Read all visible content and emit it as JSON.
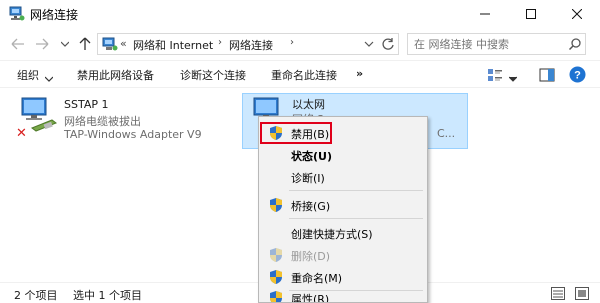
{
  "window": {
    "title": "网络连接",
    "controls": [
      "minimize",
      "maximize",
      "close"
    ]
  },
  "navigation": {
    "address_prefix": "«",
    "breadcrumbs": [
      "网络和 Internet",
      "网络连接"
    ],
    "search_placeholder": "在 网络连接 中搜索"
  },
  "toolbar": {
    "organize": "组织",
    "disable_device": "禁用此网络设备",
    "diagnose": "诊断这个连接",
    "rename": "重命名此连接",
    "more": "»"
  },
  "connections": [
    {
      "name": "SSTAP 1",
      "status": "网络电缆被拔出",
      "adapter": "TAP-Windows Adapter V9",
      "error_mark": "✕",
      "selected": false
    },
    {
      "name": "以太网",
      "status": "网络 2",
      "adapter": "C...",
      "selected": true
    }
  ],
  "context_menu": {
    "items": [
      {
        "label": "禁用(B)",
        "shield": true,
        "bold": false,
        "disabled": false,
        "highlighted": true
      },
      {
        "label": "状态(U)",
        "shield": false,
        "bold": true,
        "disabled": false
      },
      {
        "label": "诊断(I)",
        "shield": false,
        "bold": false,
        "disabled": false
      },
      {
        "label": "桥接(G)",
        "shield": true,
        "bold": false,
        "disabled": false
      },
      {
        "label": "创建快捷方式(S)",
        "shield": false,
        "bold": false,
        "disabled": false
      },
      {
        "label": "删除(D)",
        "shield": true,
        "bold": false,
        "disabled": true
      },
      {
        "label": "重命名(M)",
        "shield": true,
        "bold": false,
        "disabled": false
      },
      {
        "label": "属性(R)",
        "shield": true,
        "bold": false,
        "disabled": false
      }
    ]
  },
  "status_bar": {
    "item_count": "2 个项目",
    "selected_count": "选中 1 个项目"
  },
  "colors": {
    "selection_fill": "#cce8ff",
    "selection_border": "#99d1ff",
    "highlight_box": "#e0001a",
    "menu_background": "#f2f2f2",
    "help_icon": "#1e73d2"
  }
}
